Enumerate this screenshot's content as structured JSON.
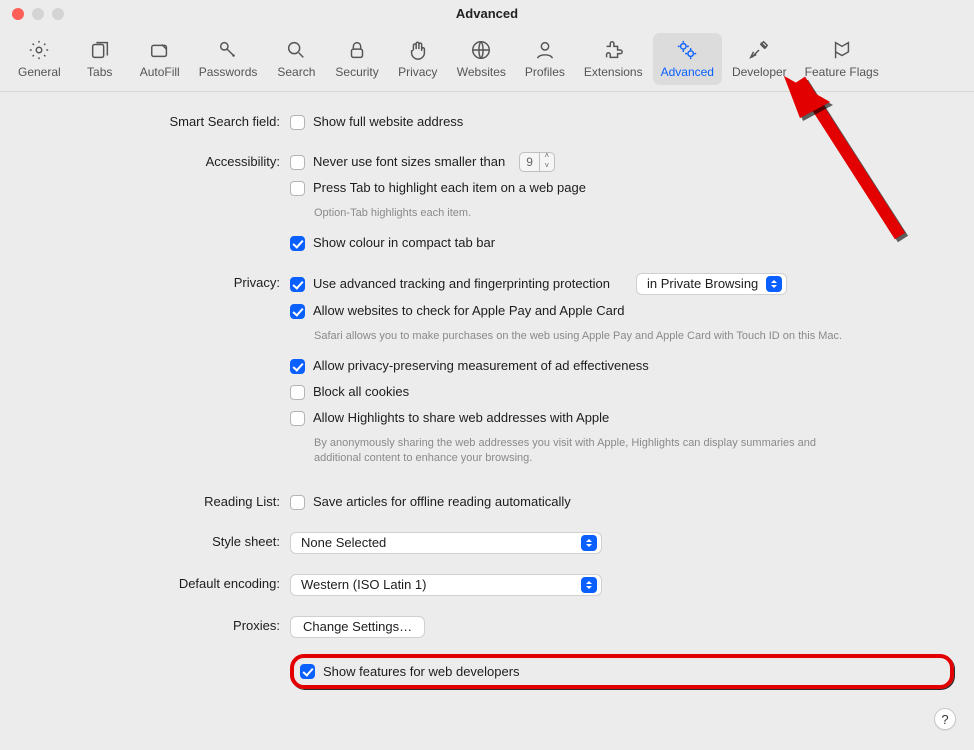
{
  "window": {
    "title": "Advanced"
  },
  "toolbar": {
    "items": [
      {
        "id": "general",
        "label": "General"
      },
      {
        "id": "tabs",
        "label": "Tabs"
      },
      {
        "id": "autofill",
        "label": "AutoFill"
      },
      {
        "id": "passwords",
        "label": "Passwords"
      },
      {
        "id": "search",
        "label": "Search"
      },
      {
        "id": "security",
        "label": "Security"
      },
      {
        "id": "privacy",
        "label": "Privacy"
      },
      {
        "id": "websites",
        "label": "Websites"
      },
      {
        "id": "profiles",
        "label": "Profiles"
      },
      {
        "id": "extensions",
        "label": "Extensions"
      },
      {
        "id": "advanced",
        "label": "Advanced"
      },
      {
        "id": "developer",
        "label": "Developer"
      },
      {
        "id": "featureflags",
        "label": "Feature Flags"
      }
    ],
    "active": "advanced"
  },
  "sections": {
    "smartsearch": {
      "label": "Smart Search field:",
      "show_full_address": {
        "checked": false,
        "label": "Show full website address"
      }
    },
    "accessibility": {
      "label": "Accessibility:",
      "min_font": {
        "checked": false,
        "label": "Never use font sizes smaller than",
        "value": "9"
      },
      "press_tab": {
        "checked": false,
        "label": "Press Tab to highlight each item on a web page",
        "hint": "Option-Tab highlights each item."
      },
      "compact_colour": {
        "checked": true,
        "label": "Show colour in compact tab bar"
      }
    },
    "privacy": {
      "label": "Privacy:",
      "tracking": {
        "checked": true,
        "label": "Use advanced tracking and fingerprinting protection",
        "scope": "in Private Browsing"
      },
      "applepay": {
        "checked": true,
        "label": "Allow websites to check for Apple Pay and Apple Card",
        "hint": "Safari allows you to make purchases on the web using Apple Pay and Apple Card with Touch ID on this Mac."
      },
      "ad_measure": {
        "checked": true,
        "label": "Allow privacy-preserving measurement of ad effectiveness"
      },
      "block_cookies": {
        "checked": false,
        "label": "Block all cookies"
      },
      "highlights": {
        "checked": false,
        "label": "Allow Highlights to share web addresses with Apple",
        "hint": "By anonymously sharing the web addresses you visit with Apple, Highlights can display summaries and additional content to enhance your browsing."
      }
    },
    "reading_list": {
      "label": "Reading List:",
      "save_offline": {
        "checked": false,
        "label": "Save articles for offline reading automatically"
      }
    },
    "style_sheet": {
      "label": "Style sheet:",
      "value": "None Selected"
    },
    "default_encoding": {
      "label": "Default encoding:",
      "value": "Western (ISO Latin 1)"
    },
    "proxies": {
      "label": "Proxies:",
      "button": "Change Settings…"
    },
    "dev_features": {
      "checked": true,
      "label": "Show features for web developers"
    }
  },
  "help": "?"
}
